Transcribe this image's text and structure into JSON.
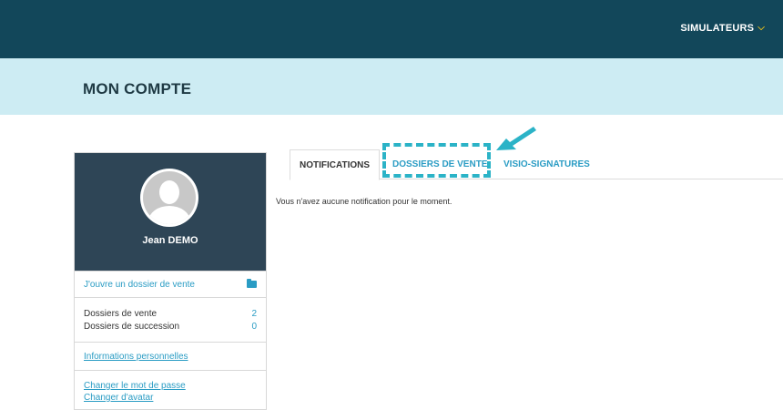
{
  "header": {
    "simulateurs_label": "SIMULATEURS",
    "simulateurs_icon": "chevron-down-icon"
  },
  "band": {
    "title": "MON COMPTE"
  },
  "profile": {
    "name": "Jean DEMO",
    "avatar_icon": "user-avatar-icon"
  },
  "sidebar": {
    "open_dossier_label": "J'ouvre un dossier de vente",
    "open_dossier_icon": "folder-icon",
    "counts": [
      {
        "label": "Dossiers de vente",
        "value": "2"
      },
      {
        "label": "Dossiers de succession",
        "value": "0"
      }
    ],
    "info_label": "Informations personnelles",
    "change_password_label": "Changer le mot de passe",
    "change_avatar_label": "Changer d'avatar"
  },
  "tabs": [
    {
      "label": "NOTIFICATIONS"
    },
    {
      "label": "DOSSIERS DE VENTE"
    },
    {
      "label": "VISIO-SIGNATURES"
    }
  ],
  "notifications": {
    "empty_text": "Vous n'avez aucune notification pour le moment."
  },
  "colors": {
    "topbar": "#12475a",
    "band": "#cdecf3",
    "profile_bg": "#2e4556",
    "accent": "#2a9cc4",
    "highlight": "#2bb3c7",
    "chevron": "#f5c518"
  }
}
